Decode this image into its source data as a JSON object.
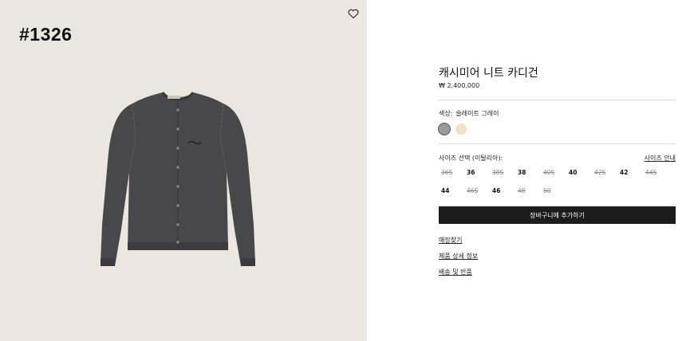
{
  "photo": {
    "tag": "#1326",
    "background": "#ebe6df",
    "wishlist_icon": "heart-icon",
    "garment_color": "#48484a"
  },
  "product": {
    "title": "캐시미어 니트 카디건",
    "price": "₩ 2,400,000"
  },
  "color": {
    "label": "색상:",
    "selected": "슬레이트 그레이",
    "swatches": [
      {
        "name": "슬레이트 그레이",
        "hex": "#9a9a9a",
        "selected": true
      },
      {
        "name": "cream",
        "hex": "#efe2c6",
        "selected": false
      }
    ]
  },
  "size": {
    "label": "사이즈 선택 (이탈리아):",
    "guide": "사이즈 안내",
    "options": [
      {
        "label": "36S",
        "available": false
      },
      {
        "label": "36",
        "available": true
      },
      {
        "label": "38S",
        "available": false
      },
      {
        "label": "38",
        "available": true
      },
      {
        "label": "40S",
        "available": false
      },
      {
        "label": "40",
        "available": true
      },
      {
        "label": "42S",
        "available": false
      },
      {
        "label": "42",
        "available": true
      },
      {
        "label": "44S",
        "available": false
      },
      {
        "label": "44",
        "available": true
      },
      {
        "label": "46S",
        "available": false
      },
      {
        "label": "46",
        "available": true
      },
      {
        "label": "48",
        "available": false
      },
      {
        "label": "50",
        "available": false
      }
    ]
  },
  "cart_button": "장바구니에 추가하기",
  "links": {
    "store": "매장찾기",
    "details": "제품 상세 정보",
    "shipping": "배송 및 반품"
  }
}
